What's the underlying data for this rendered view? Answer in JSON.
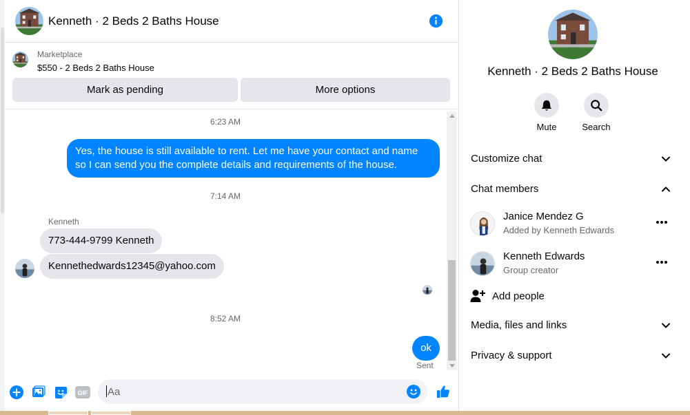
{
  "header": {
    "title": "Kenneth · 2 Beds 2 Baths House",
    "info_icon": "info-icon"
  },
  "marketplace": {
    "label": "Marketplace",
    "listing": "$550 - 2 Beds 2 Baths House",
    "mark_pending": "Mark as pending",
    "more_options": "More options"
  },
  "thread": {
    "ts1": "6:23 AM",
    "msg_out_1": "Yes, the house is still available to rent. Let me have your contact and name so I can send you the complete details and requirements of the house.",
    "ts2": "7:14 AM",
    "sender": "Kenneth",
    "msg_in_1": "773-444-9799 Kenneth",
    "msg_in_2": "Kennethedwards12345@yahoo.com",
    "ts3": "8:52 AM",
    "msg_out_2": "ok",
    "status": "Sent"
  },
  "composer": {
    "placeholder": "Aa",
    "icons": [
      "plus-icon",
      "photo-icon",
      "sticker-icon",
      "gif-icon",
      "emoji-icon",
      "thumbs-up-icon"
    ],
    "gif_label": "GIF"
  },
  "details": {
    "title": "Kenneth · 2 Beds 2 Baths House",
    "mute": "Mute",
    "search": "Search",
    "customize": "Customize chat",
    "members_header": "Chat members",
    "members": [
      {
        "name": "Janice Mendez G",
        "sub": "Added by Kenneth Edwards"
      },
      {
        "name": "Kenneth Edwards",
        "sub": "Group creator"
      }
    ],
    "add_people": "Add people",
    "media": "Media, files and links",
    "privacy": "Privacy & support"
  },
  "colors": {
    "accent": "#0084ff",
    "bubble_in": "#e4e6eb",
    "muted_text": "#65676b"
  }
}
